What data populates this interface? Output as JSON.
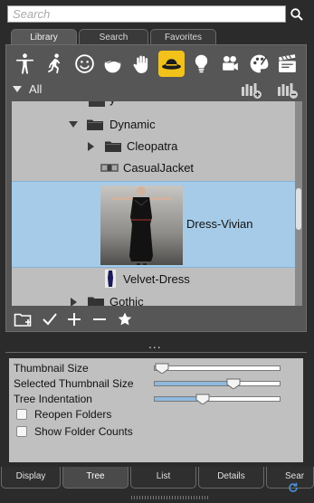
{
  "search": {
    "placeholder": "Search",
    "value": ""
  },
  "top_tabs": [
    {
      "label": "Library",
      "active": true
    },
    {
      "label": "Search",
      "active": false
    },
    {
      "label": "Favorites",
      "active": false
    }
  ],
  "category_icons": [
    "figure-icon",
    "pose-icon",
    "expression-icon",
    "hair-icon",
    "hand-icon",
    "hat-icon",
    "light-icon",
    "camera-icon",
    "material-icon",
    "scene-icon"
  ],
  "filter": {
    "label": "All"
  },
  "tree": {
    "rows": [
      {
        "label": "Dynamic"
      },
      {
        "label": "Cleopatra"
      },
      {
        "label": "CasualJacket"
      },
      {
        "label": "Dress-Vivian"
      },
      {
        "label": "Velvet-Dress"
      },
      {
        "label": "Gothic"
      }
    ]
  },
  "toolbar": {
    "more": "..."
  },
  "settings": {
    "thumbnail_size": {
      "label": "Thumbnail Size",
      "value": 0.03
    },
    "selected_thumbnail_size": {
      "label": "Selected Thumbnail Size",
      "value": 0.63
    },
    "tree_indentation": {
      "label": "Tree Indentation",
      "value": 0.39
    },
    "reopen_folders": {
      "label": "Reopen Folders",
      "checked": false
    },
    "show_folder_counts": {
      "label": "Show Folder Counts",
      "checked": false
    }
  },
  "bottom_tabs": [
    {
      "label": "Display",
      "active": false
    },
    {
      "label": "Tree",
      "active": true
    },
    {
      "label": "List",
      "active": false
    },
    {
      "label": "Details",
      "active": false
    },
    {
      "label": "Sear",
      "active": false
    }
  ],
  "colors": {
    "accent": "#f2c21a",
    "selection": "#a6cbe8",
    "panel": "#2b2b2b"
  }
}
